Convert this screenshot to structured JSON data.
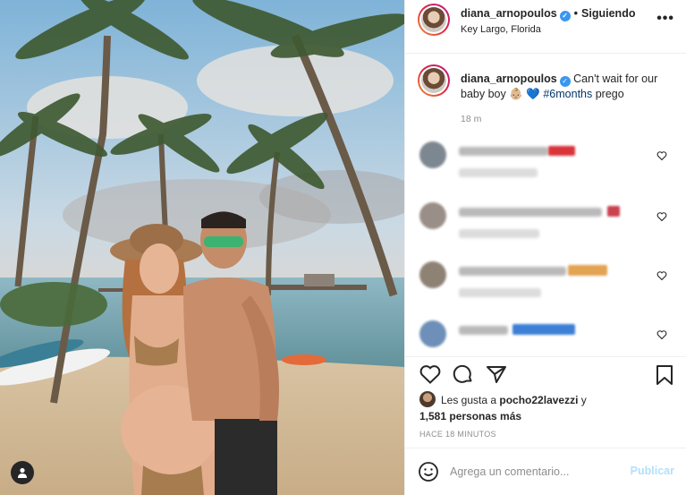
{
  "post": {
    "username": "diana_arnopoulos",
    "follow_state": "Siguiendo",
    "location": "Key Largo, Florida",
    "separator": "•",
    "more_label": "•••"
  },
  "caption": {
    "username": "diana_arnopoulos",
    "text_before": "Can't wait for our baby boy",
    "emoji_baby": "👶🏼",
    "emoji_heart": "💙",
    "hashtag": "#6months",
    "text_after": "prego",
    "time": "18 m"
  },
  "comments": [
    {
      "blurred": true
    },
    {
      "blurred": true
    },
    {
      "blurred": true
    },
    {
      "blurred": true
    }
  ],
  "likes": {
    "prefix": "Les gusta a",
    "user": "pocho22lavezzi",
    "connector": "y",
    "count": "1,581 personas más"
  },
  "time_ago": "HACE 18 MINUTOS",
  "comment_box": {
    "placeholder": "Agrega un comentario...",
    "post_label": "Publicar"
  },
  "colors": {
    "accent_blue": "#3897f0",
    "post_button_disabled": "#b2dffc",
    "hashtag": "#00376b",
    "muted_text": "#8e8e8e"
  },
  "icons": [
    "user-tag-icon",
    "verified-icon",
    "more-icon",
    "heart-icon",
    "comment-icon",
    "share-icon",
    "bookmark-icon",
    "emoji-icon"
  ]
}
